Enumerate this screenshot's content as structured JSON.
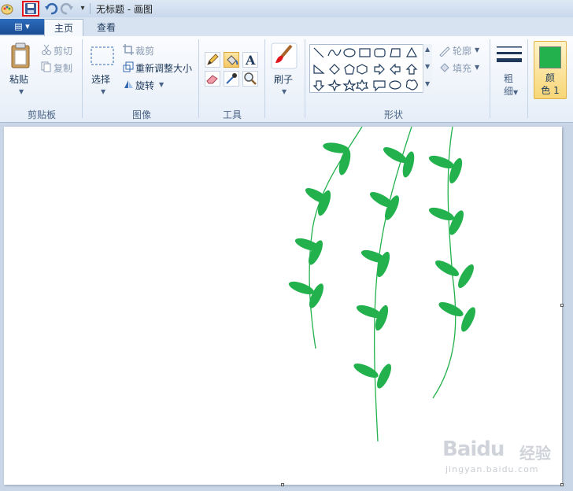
{
  "window": {
    "title": "无标题 - 画图"
  },
  "quick_access": {
    "menu_arrow": "▾"
  },
  "tabs": [
    {
      "label": "主页"
    },
    {
      "label": "查看"
    }
  ],
  "app_menu": {
    "label": "▤ ▾"
  },
  "ribbon": {
    "clipboard": {
      "group": "剪贴板",
      "paste": "粘贴",
      "cut": "剪切",
      "copy": "复制"
    },
    "image": {
      "group": "图像",
      "select": "选择",
      "crop": "裁剪",
      "resize": "重新调整大小",
      "rotate": "旋转"
    },
    "tools": {
      "group": "工具"
    },
    "brush": {
      "label": "刷子"
    },
    "shapes": {
      "group": "形状",
      "outline": "轮廓",
      "fill": "填充"
    },
    "size": {
      "label": "粗\n细"
    },
    "color1": {
      "label": "颜\n色 1",
      "color": "#22b14c"
    }
  },
  "canvas": {
    "background": "#ffffff",
    "leaf_color": "#22b14c"
  },
  "watermark": {
    "brand": "Baidu",
    "brand_cn": "经验",
    "url": "jingyan.baidu.com"
  }
}
